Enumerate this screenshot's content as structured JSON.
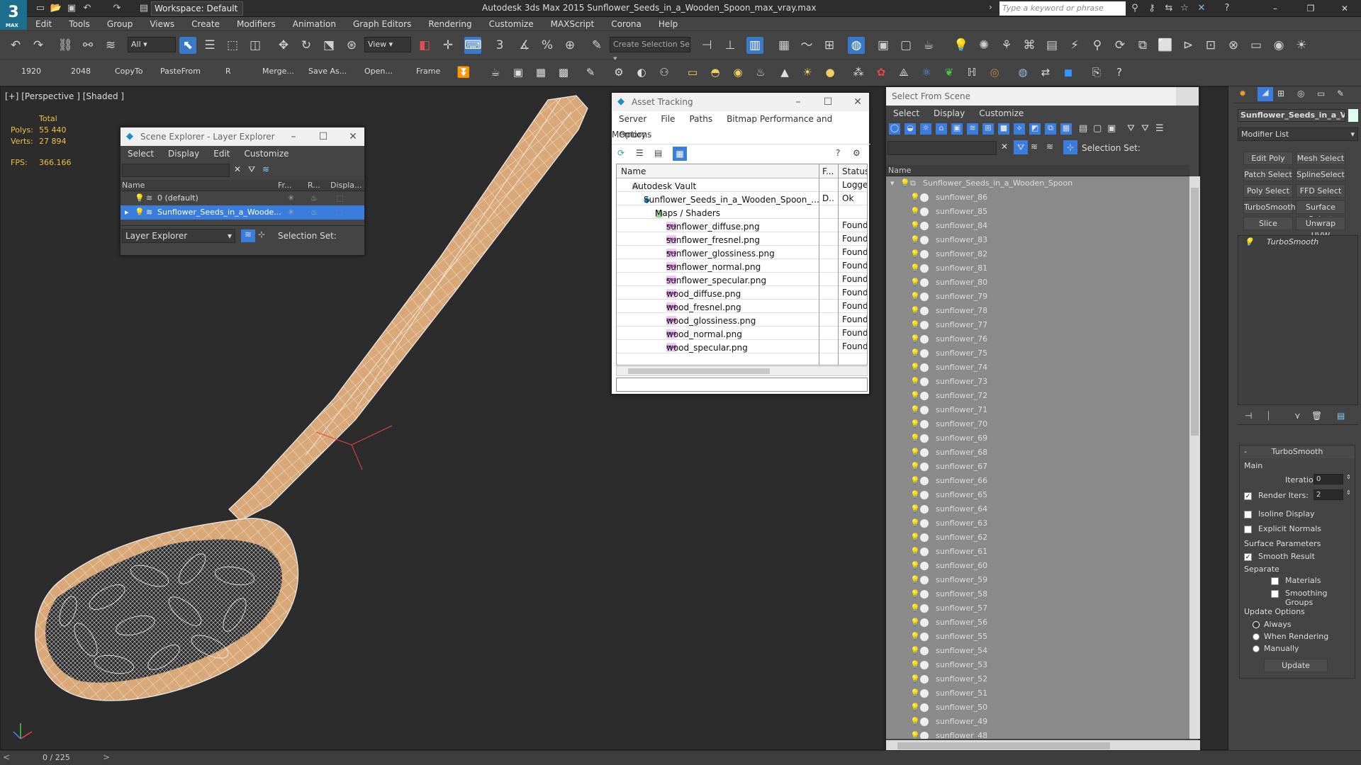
{
  "app": {
    "logo_text": "3",
    "logo_sub": "MAX",
    "workspace_label": "Workspace: Default",
    "title": "Autodesk 3ds Max  2015     Sunflower_Seeds_in_a_Wooden_Spoon_max_vray.max",
    "search_placeholder": "Type a keyword or phrase"
  },
  "menu": [
    "Edit",
    "Tools",
    "Group",
    "Views",
    "Create",
    "Modifiers",
    "Animation",
    "Graph Editors",
    "Rendering",
    "Customize",
    "MAXScript",
    "Corona",
    "Help"
  ],
  "toolbar1": {
    "filter_select": "All",
    "refcoord_select": "View",
    "selection_set_placeholder": "Create Selection Se"
  },
  "toolbar2": {
    "labels": [
      "1920",
      "2048",
      "CopyTo",
      "PasteFrom",
      "R",
      "Merge...",
      "Save As...",
      "Open...",
      "Frame"
    ]
  },
  "viewport": {
    "label": "[+] [Perspective ] [Shaded ]",
    "stats_total": "Total",
    "polys_label": "Polys:",
    "polys_value": "55 440",
    "verts_label": "Verts:",
    "verts_value": "27 894",
    "fps_label": "FPS:",
    "fps_value": "366.166"
  },
  "scene_explorer": {
    "title": "Scene Explorer - Layer Explorer",
    "menu": [
      "Select",
      "Display",
      "Edit",
      "Customize"
    ],
    "columns": [
      "Name",
      "Fr...",
      "R...",
      "Displa..."
    ],
    "rows": [
      {
        "name": "0 (default)",
        "selected": false
      },
      {
        "name": "Sunflower_Seeds_in_a_Woode...",
        "selected": true
      }
    ],
    "footer_select": "Layer Explorer",
    "footer_selset": "Selection Set:"
  },
  "asset_tracking": {
    "title": "Asset Tracking",
    "menu": [
      "Server",
      "File",
      "Paths",
      "Bitmap Performance and Memory"
    ],
    "menu2": "Options",
    "columns": [
      "Name",
      "F...",
      "Status"
    ],
    "rows": [
      {
        "name": "Autodesk Vault",
        "f": "",
        "status": "Logged",
        "indent": 1,
        "type": "vault"
      },
      {
        "name": "Sunflower_Seeds_in_a_Wooden_Spoon_...",
        "f": "D..",
        "status": "Ok",
        "indent": 2,
        "type": "max"
      },
      {
        "name": "Maps / Shaders",
        "f": "",
        "status": "",
        "indent": 3,
        "type": "folder"
      },
      {
        "name": "sunflower_diffuse.png",
        "f": "",
        "status": "Found",
        "indent": 4,
        "type": "png"
      },
      {
        "name": "sunflower_fresnel.png",
        "f": "",
        "status": "Found",
        "indent": 4,
        "type": "png"
      },
      {
        "name": "sunflower_glossiness.png",
        "f": "",
        "status": "Found",
        "indent": 4,
        "type": "png"
      },
      {
        "name": "sunflower_normal.png",
        "f": "",
        "status": "Found",
        "indent": 4,
        "type": "png"
      },
      {
        "name": "sunflower_specular.png",
        "f": "",
        "status": "Found",
        "indent": 4,
        "type": "png"
      },
      {
        "name": "wood_diffuse.png",
        "f": "",
        "status": "Found",
        "indent": 4,
        "type": "png"
      },
      {
        "name": "wood_fresnel.png",
        "f": "",
        "status": "Found",
        "indent": 4,
        "type": "png"
      },
      {
        "name": "wood_glossiness.png",
        "f": "",
        "status": "Found",
        "indent": 4,
        "type": "png"
      },
      {
        "name": "wood_normal.png",
        "f": "",
        "status": "Found",
        "indent": 4,
        "type": "png"
      },
      {
        "name": "wood_specular.png",
        "f": "",
        "status": "Found",
        "indent": 4,
        "type": "png"
      }
    ]
  },
  "select_from_scene": {
    "title": "Select From Scene",
    "menu": [
      "Select",
      "Display",
      "Customize"
    ],
    "selset_label": "Selection Set:",
    "col_name": "Name",
    "root": "Sunflower_Seeds_in_a_Wooden_Spoon",
    "items": [
      "sunflower_86",
      "sunflower_85",
      "sunflower_84",
      "sunflower_83",
      "sunflower_82",
      "sunflower_81",
      "sunflower_80",
      "sunflower_79",
      "sunflower_78",
      "sunflower_77",
      "sunflower_76",
      "sunflower_75",
      "sunflower_74",
      "sunflower_73",
      "sunflower_72",
      "sunflower_71",
      "sunflower_70",
      "sunflower_69",
      "sunflower_68",
      "sunflower_67",
      "sunflower_66",
      "sunflower_65",
      "sunflower_64",
      "sunflower_63",
      "sunflower_62",
      "sunflower_61",
      "sunflower_60",
      "sunflower_59",
      "sunflower_58",
      "sunflower_57",
      "sunflower_56",
      "sunflower_55",
      "sunflower_54",
      "sunflower_53",
      "sunflower_52",
      "sunflower_51",
      "sunflower_50",
      "sunflower_49",
      "sunflower_48"
    ]
  },
  "command_panel": {
    "object_name": "Sunflower_Seeds_in_a_V",
    "modifier_list": "Modifier List",
    "buttons": [
      "Edit Poly",
      "Mesh Select",
      "Patch Select",
      "SplineSelect",
      "Poly Select",
      "FFD Select",
      "TurboSmooth",
      "Surface Select",
      "Slice",
      "Unwrap UVW"
    ],
    "stack_item": "TurboSmooth",
    "rollout_title": "TurboSmooth",
    "main_label": "Main",
    "iterations_label": "Iterations:",
    "iterations_value": "0",
    "render_iters_label": "Render Iters:",
    "render_iters_value": "2",
    "isoline": "Isoline Display",
    "explicit_normals": "Explicit Normals",
    "surface_params": "Surface Parameters",
    "smooth_result": "Smooth Result",
    "separate": "Separate",
    "materials": "Materials",
    "smoothing_groups": "Smoothing Groups",
    "update_options": "Update Options",
    "always": "Always",
    "when_rendering": "When Rendering",
    "manually": "Manually",
    "update_btn": "Update"
  },
  "statusbar": {
    "frame_counter": "0 / 225"
  },
  "colors": {
    "accent": "#3b7ddd",
    "stat_yellow": "#f0c040",
    "spoon_wood": "#d9a878"
  }
}
